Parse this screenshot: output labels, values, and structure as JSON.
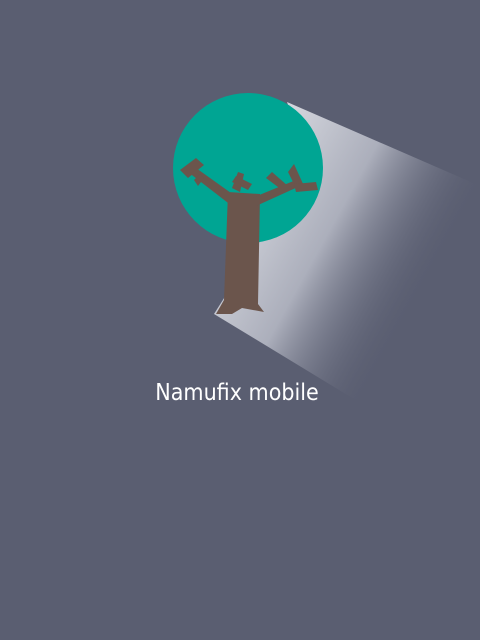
{
  "splash": {
    "app_name": "Namufix mobile",
    "logo_icon": "tree-with-light-beam-icon"
  },
  "colors": {
    "background": "#5a5e71",
    "foliage": "#00a593",
    "trunk": "#6b554c",
    "beam_light": "#cfd1d9",
    "text": "#ffffff"
  }
}
